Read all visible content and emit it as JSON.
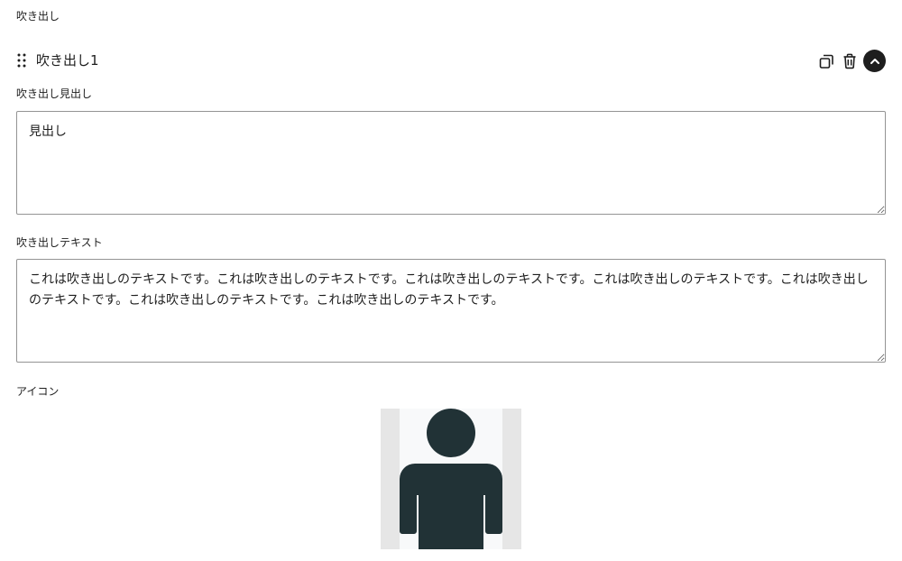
{
  "section": {
    "label": "吹き出し"
  },
  "item": {
    "title": "吹き出し1",
    "actions": {
      "duplicate_icon": "copy-icon",
      "delete_icon": "trash-icon",
      "collapse_icon": "chevron-up-icon"
    }
  },
  "fields": {
    "heading": {
      "label": "吹き出し見出し",
      "value": "見出し"
    },
    "text": {
      "label": "吹き出しテキスト",
      "value": "これは吹き出しのテキストです。これは吹き出しのテキストです。これは吹き出しのテキストです。これは吹き出しのテキストです。これは吹き出しのテキストです。これは吹き出しのテキストです。これは吹き出しのテキストです。"
    },
    "icon": {
      "label": "アイコン",
      "image": "person-silhouette"
    }
  },
  "colors": {
    "text": "#1e1e1e",
    "border": "#949494",
    "avatar_fill": "#213236",
    "avatar_bg": "#e6e6e6"
  }
}
